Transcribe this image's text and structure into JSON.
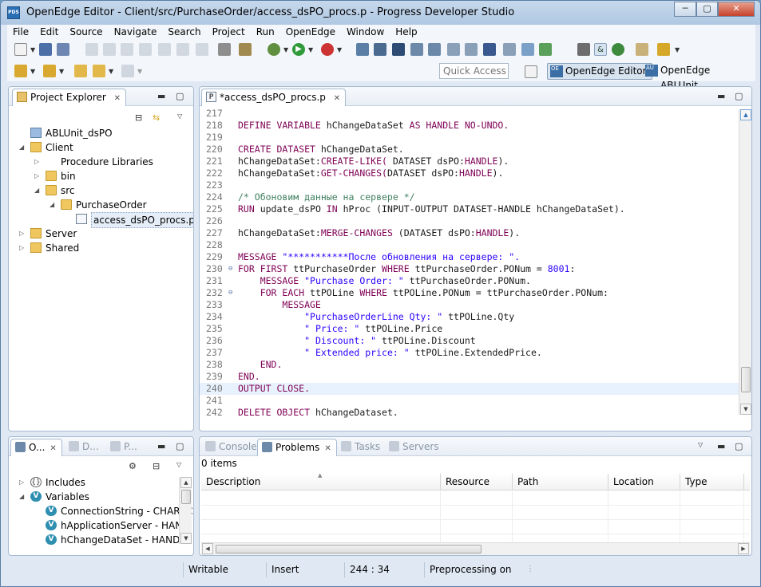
{
  "window": {
    "title": "OpenEdge Editor - Client/src/PurchaseOrder/access_dsPO_procs.p - Progress Developer Studio",
    "icon_label": "PDS",
    "controls": {
      "minimize": "─",
      "maximize": "▢",
      "close": "✕"
    }
  },
  "menu": [
    "File",
    "Edit",
    "Source",
    "Navigate",
    "Search",
    "Project",
    "Run",
    "OpenEdge",
    "Window",
    "Help"
  ],
  "toolbar": {
    "quick_access_placeholder": "Quick Access",
    "perspectives": [
      {
        "label": "OpenEdge Editor",
        "icon": "openedge-editor-perspective-icon",
        "icon_text": "OE",
        "active": true
      },
      {
        "label": "OpenEdge ABLUnit",
        "icon": "ablunit-perspective-icon",
        "icon_text": "AU",
        "active": false
      }
    ]
  },
  "project_explorer": {
    "tab_label": "Project Explorer",
    "tree": [
      {
        "label": "ABLUnit_dsPO",
        "depth": 1,
        "expand": "",
        "icon": "project-folder-icon"
      },
      {
        "label": "Client",
        "depth": 1,
        "expand": "◢",
        "icon": "openedge-project-icon"
      },
      {
        "label": "Procedure Libraries",
        "depth": 2,
        "expand": "▷",
        "icon": "library-icon"
      },
      {
        "label": "bin",
        "depth": 2,
        "expand": "▷",
        "icon": "folder-icon"
      },
      {
        "label": "src",
        "depth": 2,
        "expand": "◢",
        "icon": "folder-icon"
      },
      {
        "label": "PurchaseOrder",
        "depth": 3,
        "expand": "◢",
        "icon": "folder-icon"
      },
      {
        "label": "access_dsPO_procs.p",
        "depth": 4,
        "expand": "",
        "icon": "procedure-file-icon",
        "selected": true
      },
      {
        "label": "Server",
        "depth": 1,
        "expand": "▷",
        "icon": "openedge-project-icon"
      },
      {
        "label": "Shared",
        "depth": 1,
        "expand": "▷",
        "icon": "openedge-project-icon"
      }
    ]
  },
  "outline": {
    "tabs": [
      {
        "label": "O...",
        "icon": "outline-icon",
        "active": true
      },
      {
        "label": "D...",
        "icon": "database-icon",
        "active": false
      },
      {
        "label": "P...",
        "icon": "properties-icon",
        "active": false
      }
    ],
    "tree": [
      {
        "label": "Includes",
        "depth": 1,
        "expand": "▷",
        "icon": "includes-icon",
        "icon_text": "{}"
      },
      {
        "label": "Variables",
        "depth": 1,
        "expand": "◢",
        "icon": "variables-icon",
        "icon_text": "V"
      },
      {
        "label": "ConnectionString - CHARAC",
        "depth": 2,
        "expand": "",
        "icon": "variable-icon",
        "icon_text": "V"
      },
      {
        "label": "hApplicationServer - HANDI",
        "depth": 2,
        "expand": "",
        "icon": "variable-icon",
        "icon_text": "V"
      },
      {
        "label": "hChangeDataSet - HANDLE",
        "depth": 2,
        "expand": "",
        "icon": "variable-icon",
        "icon_text": "V"
      }
    ]
  },
  "editor": {
    "tab_label": "*access_dsPO_procs.p",
    "tab_icon_text": "P",
    "current_line": "240",
    "lines": [
      {
        "n": "217",
        "fold": "",
        "indent": 0,
        "parts": []
      },
      {
        "n": "218",
        "fold": "",
        "indent": 0,
        "parts": [
          {
            "t": "DEFINE VARIABLE",
            "c": "kw"
          },
          {
            "t": " hChangeDataSet ",
            "c": "ident"
          },
          {
            "t": "AS",
            "c": "kw"
          },
          {
            "t": " HANDLE NO-UNDO.",
            "c": "kw"
          }
        ]
      },
      {
        "n": "219",
        "fold": "",
        "indent": 0,
        "parts": []
      },
      {
        "n": "220",
        "fold": "",
        "indent": 0,
        "parts": [
          {
            "t": "CREATE DATASET",
            "c": "kw"
          },
          {
            "t": " hChangeDataSet.",
            "c": "ident"
          }
        ]
      },
      {
        "n": "221",
        "fold": "",
        "indent": 0,
        "parts": [
          {
            "t": "hChangeDataSet:",
            "c": "ident"
          },
          {
            "t": "CREATE-LIKE(",
            "c": "kw"
          },
          {
            "t": " DATASET dsPO:",
            "c": "ident"
          },
          {
            "t": "HANDLE",
            "c": "kw"
          },
          {
            "t": ").",
            "c": "ident"
          }
        ]
      },
      {
        "n": "222",
        "fold": "",
        "indent": 0,
        "parts": [
          {
            "t": "hChangeDataSet:",
            "c": "ident"
          },
          {
            "t": "GET-CHANGES(",
            "c": "kw"
          },
          {
            "t": "DATASET dsPO:",
            "c": "ident"
          },
          {
            "t": "HANDLE",
            "c": "kw"
          },
          {
            "t": ").",
            "c": "ident"
          }
        ]
      },
      {
        "n": "223",
        "fold": "",
        "indent": 0,
        "parts": []
      },
      {
        "n": "224",
        "fold": "",
        "indent": 0,
        "parts": [
          {
            "t": "/* Обоновим данные на сервере */",
            "c": "cmt"
          }
        ]
      },
      {
        "n": "225",
        "fold": "",
        "indent": 0,
        "parts": [
          {
            "t": "RUN",
            "c": "kw"
          },
          {
            "t": " update_dsPO ",
            "c": "ident"
          },
          {
            "t": "IN",
            "c": "kw"
          },
          {
            "t": " hProc (INPUT-OUTPUT DATASET-HANDLE hChangeDataSet).",
            "c": "ident"
          }
        ]
      },
      {
        "n": "226",
        "fold": "",
        "indent": 0,
        "parts": []
      },
      {
        "n": "227",
        "fold": "",
        "indent": 0,
        "parts": [
          {
            "t": "hChangeDataSet:",
            "c": "ident"
          },
          {
            "t": "MERGE-CHANGES",
            "c": "kw"
          },
          {
            "t": " (DATASET dsPO:",
            "c": "ident"
          },
          {
            "t": "HANDLE",
            "c": "kw"
          },
          {
            "t": ").",
            "c": "ident"
          }
        ]
      },
      {
        "n": "228",
        "fold": "",
        "indent": 0,
        "parts": []
      },
      {
        "n": "229",
        "fold": "",
        "indent": 0,
        "parts": [
          {
            "t": "MESSAGE",
            "c": "kw"
          },
          {
            "t": " \"***********После обновления на сервере: \".",
            "c": "str"
          }
        ]
      },
      {
        "n": "230",
        "fold": "⊖",
        "indent": 0,
        "parts": [
          {
            "t": "FOR FIRST",
            "c": "kw"
          },
          {
            "t": " ttPurchaseOrder ",
            "c": "ident"
          },
          {
            "t": "WHERE",
            "c": "kw"
          },
          {
            "t": " ttPurchaseOrder.PONum = ",
            "c": "ident"
          },
          {
            "t": "8001",
            "c": "str"
          },
          {
            "t": ":",
            "c": "ident"
          }
        ]
      },
      {
        "n": "231",
        "fold": "",
        "indent": 4,
        "parts": [
          {
            "t": "MESSAGE",
            "c": "kw"
          },
          {
            "t": " \"Purchase Order: \"",
            "c": "str"
          },
          {
            "t": " ttPurchaseOrder.PONum.",
            "c": "ident"
          }
        ]
      },
      {
        "n": "232",
        "fold": "⊖",
        "indent": 4,
        "parts": [
          {
            "t": "FOR EACH",
            "c": "kw"
          },
          {
            "t": " ttPOLine ",
            "c": "ident"
          },
          {
            "t": "WHERE",
            "c": "kw"
          },
          {
            "t": " ttPOLine.PONum = ttPurchaseOrder.PONum:",
            "c": "ident"
          }
        ]
      },
      {
        "n": "233",
        "fold": "",
        "indent": 8,
        "parts": [
          {
            "t": "MESSAGE",
            "c": "kw"
          }
        ]
      },
      {
        "n": "234",
        "fold": "",
        "indent": 12,
        "parts": [
          {
            "t": "\"PurchaseOrderLine Qty: \"",
            "c": "str"
          },
          {
            "t": " ttPOLine.Qty",
            "c": "ident"
          }
        ]
      },
      {
        "n": "235",
        "fold": "",
        "indent": 12,
        "parts": [
          {
            "t": "\" Price: \"",
            "c": "str"
          },
          {
            "t": " ttPOLine.Price",
            "c": "ident"
          }
        ]
      },
      {
        "n": "236",
        "fold": "",
        "indent": 12,
        "parts": [
          {
            "t": "\" Discount: \"",
            "c": "str"
          },
          {
            "t": " ttPOLine.Discount",
            "c": "ident"
          }
        ]
      },
      {
        "n": "237",
        "fold": "",
        "indent": 12,
        "parts": [
          {
            "t": "\" Extended price: \"",
            "c": "str"
          },
          {
            "t": " ttPOLine.ExtendedPrice.",
            "c": "ident"
          }
        ]
      },
      {
        "n": "238",
        "fold": "",
        "indent": 4,
        "parts": [
          {
            "t": "END.",
            "c": "kw"
          }
        ]
      },
      {
        "n": "239",
        "fold": "",
        "indent": 0,
        "parts": [
          {
            "t": "END.",
            "c": "kw"
          }
        ]
      },
      {
        "n": "240",
        "fold": "",
        "indent": 0,
        "parts": [
          {
            "t": "OUTPUT CLOSE.",
            "c": "kw"
          }
        ]
      },
      {
        "n": "241",
        "fold": "",
        "indent": 0,
        "parts": []
      },
      {
        "n": "242",
        "fold": "",
        "indent": 0,
        "parts": [
          {
            "t": "DELETE OBJECT",
            "c": "kw"
          },
          {
            "t": " hChangeDataset.",
            "c": "ident"
          }
        ]
      }
    ]
  },
  "bottom_panel": {
    "tabs": [
      {
        "label": "Console",
        "icon": "console-icon",
        "active": false
      },
      {
        "label": "Problems",
        "icon": "problems-icon",
        "active": true
      },
      {
        "label": "Tasks",
        "icon": "tasks-icon",
        "active": false
      },
      {
        "label": "Servers",
        "icon": "servers-icon",
        "active": false
      }
    ],
    "summary": "0 items",
    "columns": [
      "Description",
      "Resource",
      "Path",
      "Location",
      "Type"
    ]
  },
  "status_bar": {
    "writable": "Writable",
    "insert_mode": "Insert",
    "cursor_position": "244 : 34",
    "preprocessing": "Preprocessing on"
  },
  "colors": {
    "keyword": "#7f0055",
    "string": "#2a00ff",
    "comment": "#3f7f5f",
    "current_line": "#e8f2fe"
  }
}
